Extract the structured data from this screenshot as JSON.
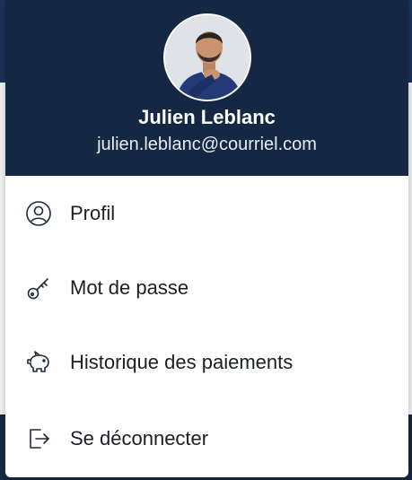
{
  "user": {
    "name": "Julien Leblanc",
    "email": "julien.leblanc@courriel.com",
    "avatar_icon": "avatar-photo"
  },
  "menu": {
    "items": [
      {
        "label": "Profil",
        "icon": "user-circle-icon"
      },
      {
        "label": "Mot de passe",
        "icon": "key-icon"
      },
      {
        "label": "Historique des paiements",
        "icon": "piggy-bank-icon"
      },
      {
        "label": "Se déconnecter",
        "icon": "logout-icon"
      }
    ]
  },
  "colors": {
    "header_bg": "#142843",
    "text": "#1b1f24",
    "icon": "#1f2a38"
  }
}
